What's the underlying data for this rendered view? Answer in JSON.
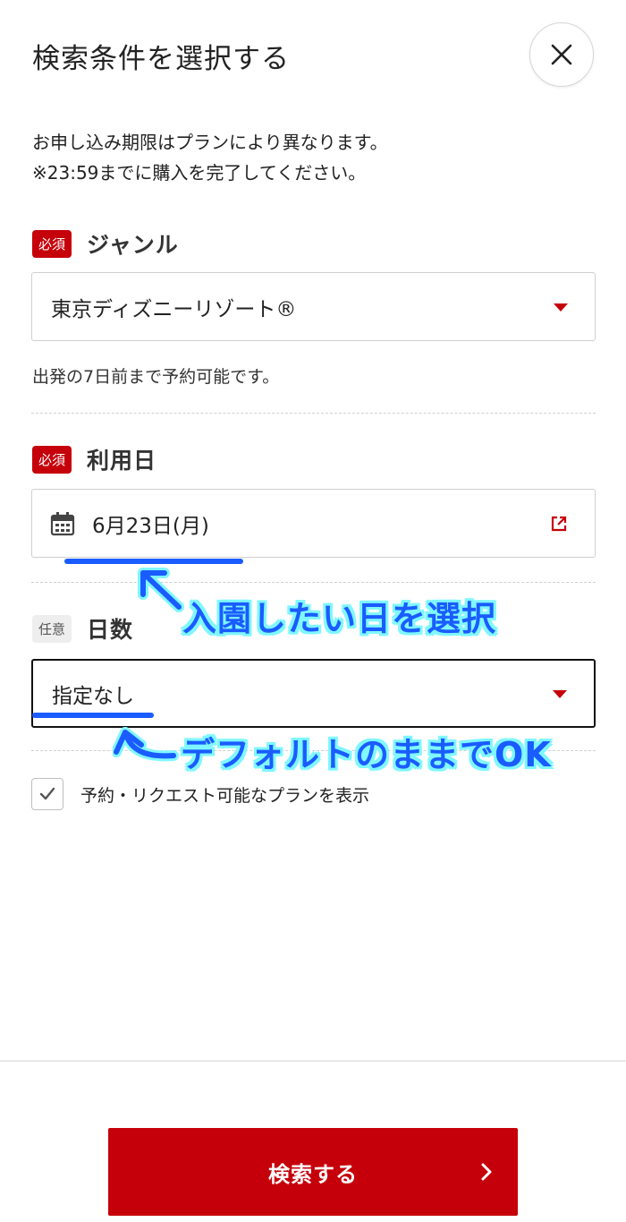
{
  "header": {
    "title": "検索条件を選択する",
    "close_icon": "close-icon"
  },
  "notice": {
    "line1": "お申し込み期限はプランにより異なります。",
    "line2": "※23:59までに購入を完了してください。"
  },
  "genre": {
    "badge": "必須",
    "label": "ジャンル",
    "value": "東京ディズニーリゾート®",
    "helper": "出発の7日前まで予約可能です。"
  },
  "date": {
    "badge": "必須",
    "label": "利用日",
    "value": "6月23日(月)",
    "icon": "calendar-icon",
    "action_icon": "open-external-icon"
  },
  "days": {
    "badge": "任意",
    "label": "日数",
    "value": "指定なし"
  },
  "filter": {
    "checked": true,
    "label": "予約・リクエスト可能なプランを表示"
  },
  "footer": {
    "search_label": "検索する",
    "chevron_icon": "chevron-right-icon"
  },
  "annotations": {
    "date_note": "入園したい日を選択",
    "days_note": "デフォルトのままでOK"
  },
  "colors": {
    "accent": "#c6000a",
    "annotation": "#1a5cff",
    "annotation_glow": "#7ff7ff"
  }
}
